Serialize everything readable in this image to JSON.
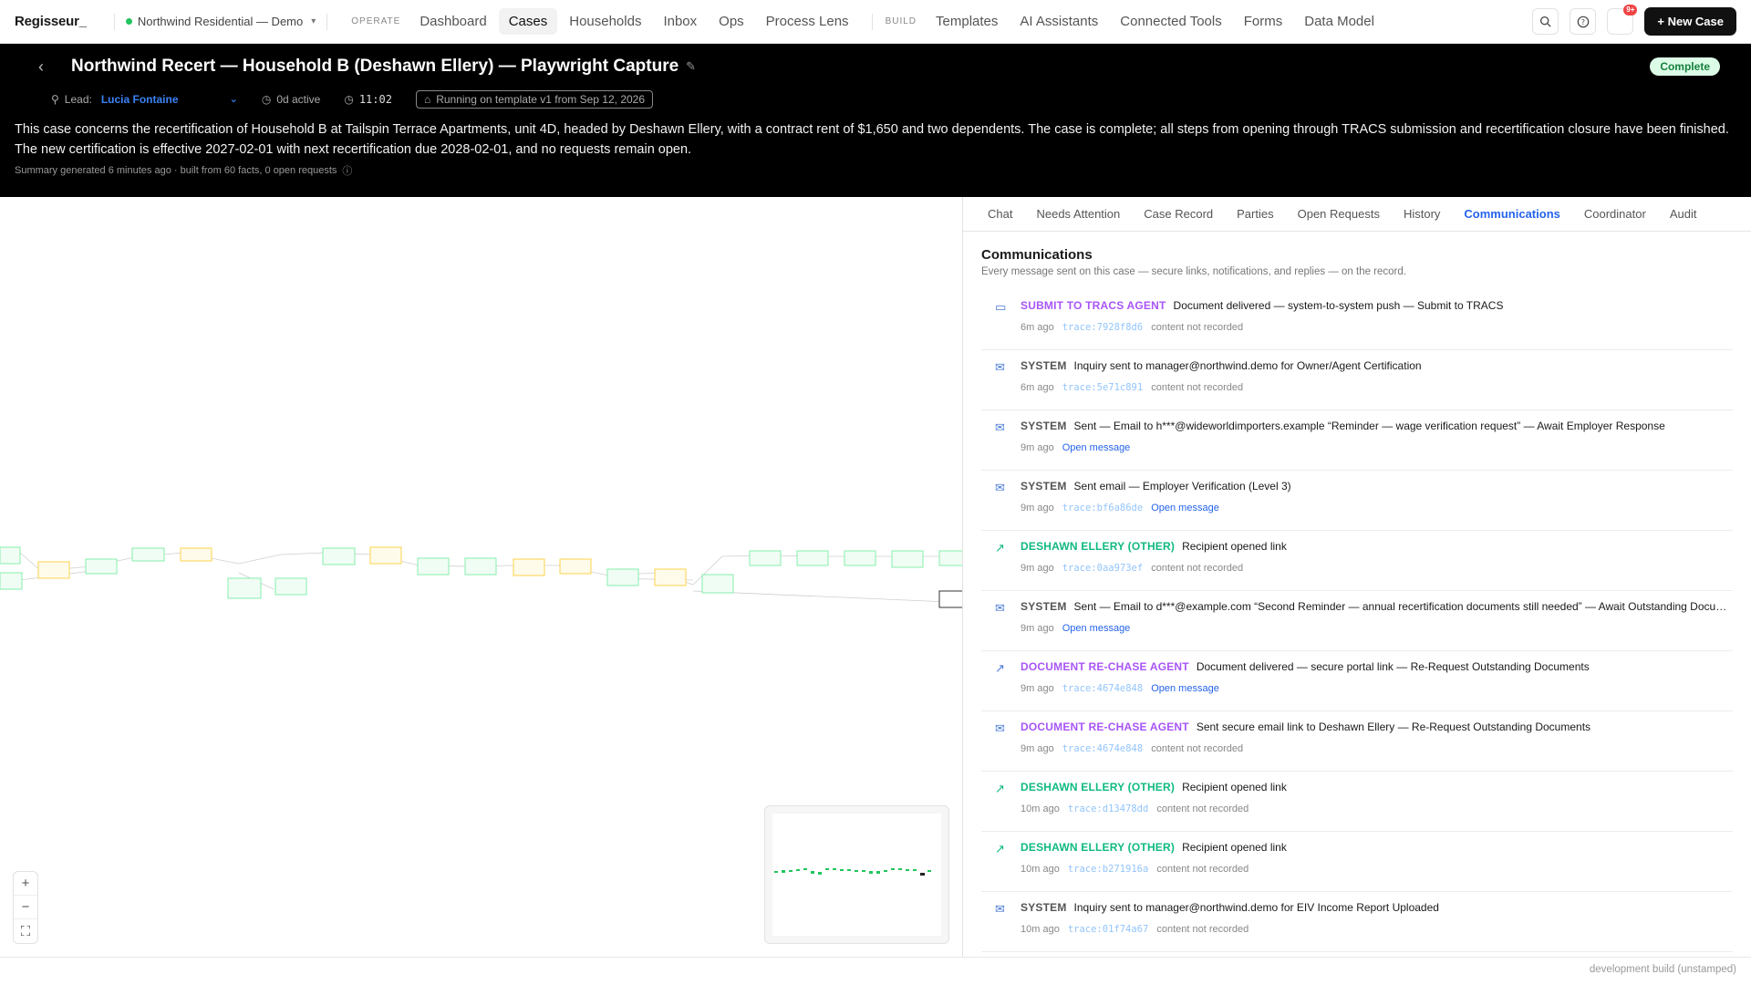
{
  "brand": "Regisseur_",
  "workspace": "Northwind Residential — Demo",
  "nav": {
    "operate_label": "OPERATE",
    "operate_items": [
      "Dashboard",
      "Cases",
      "Households",
      "Inbox",
      "Ops",
      "Process Lens"
    ],
    "build_label": "BUILD",
    "build_items": [
      "Templates",
      "AI Assistants",
      "Connected Tools",
      "Forms",
      "Data Model"
    ],
    "notifications_badge": "9+",
    "new_case_label": "+ New Case"
  },
  "case": {
    "title": "Northwind Recert — Household B (Deshawn Ellery) — Playwright Capture",
    "status": "Complete",
    "lead_label": "Lead:",
    "lead_value": "Lucia Fontaine",
    "active": "0d active",
    "timer": "11:02",
    "template": "Running on template v1 from Sep 12, 2026",
    "summary": "This case concerns the recertification of Household B at Tailspin Terrace Apartments, unit 4D, headed by Deshawn Ellery, with a contract rent of $1,650 and two dependents. The case is complete; all steps from opening through TRACS submission and recertification closure have been finished. The new certification is effective 2027-02-01 with next recertification due 2028-02-01, and no requests remain open.",
    "summary_footer": "Summary generated 6 minutes ago · built from 60 facts, 0 open requests"
  },
  "tabs": [
    "Chat",
    "Needs Attention",
    "Case Record",
    "Parties",
    "Open Requests",
    "History",
    "Communications",
    "Coordinator",
    "Audit"
  ],
  "active_tab": "Communications",
  "communications": {
    "title": "Communications",
    "subtitle": "Every message sent on this case — secure links, notifications, and replies — on the record.",
    "items": [
      {
        "icon": "chat-icon",
        "who": "SUBMIT TO TRACS AGENT",
        "kind": "agent",
        "msg": "Document delivered — system-to-system push — Submit to TRACS",
        "time": "6m ago",
        "trace": "trace:7928f8d6",
        "extra": "content not recorded"
      },
      {
        "icon": "mail-icon",
        "who": "SYSTEM",
        "kind": "system",
        "msg": "Inquiry sent to manager@northwind.demo for Owner/Agent Certification",
        "time": "6m ago",
        "trace": "trace:5e71c891",
        "extra": "content not recorded"
      },
      {
        "icon": "mail-icon",
        "who": "SYSTEM",
        "kind": "system",
        "msg": "Sent — Email to h***@wideworldimporters.example “Reminder — wage verification request” — Await Employer Response",
        "time": "9m ago",
        "trace": "",
        "extra": "Open message"
      },
      {
        "icon": "mail-icon",
        "who": "SYSTEM",
        "kind": "system",
        "msg": "Sent email — Employer Verification (Level 3)",
        "time": "9m ago",
        "trace": "trace:bf6a86de",
        "extra": "Open message"
      },
      {
        "icon": "external-link-icon",
        "who": "DESHAWN ELLERY (OTHER)",
        "kind": "other",
        "msg": "Recipient opened link",
        "time": "9m ago",
        "trace": "trace:0aa973ef",
        "extra": "content not recorded"
      },
      {
        "icon": "mail-icon",
        "who": "SYSTEM",
        "kind": "system",
        "msg": "Sent — Email to d***@example.com “Second Reminder — annual recertification documents still needed” — Await Outstanding Documents",
        "time": "9m ago",
        "trace": "",
        "extra": "Open message"
      },
      {
        "icon": "external-link-icon",
        "who": "DOCUMENT RE-CHASE AGENT",
        "kind": "agent",
        "msg": "Document delivered — secure portal link — Re-Request Outstanding Documents",
        "time": "9m ago",
        "trace": "trace:4674e848",
        "extra": "Open message"
      },
      {
        "icon": "mail-icon",
        "who": "DOCUMENT RE-CHASE AGENT",
        "kind": "agent",
        "msg": "Sent secure email link to Deshawn Ellery — Re-Request Outstanding Documents",
        "time": "9m ago",
        "trace": "trace:4674e848",
        "extra": "content not recorded"
      },
      {
        "icon": "external-link-icon",
        "who": "DESHAWN ELLERY (OTHER)",
        "kind": "other",
        "msg": "Recipient opened link",
        "time": "10m ago",
        "trace": "trace:d13478dd",
        "extra": "content not recorded"
      },
      {
        "icon": "external-link-icon",
        "who": "DESHAWN ELLERY (OTHER)",
        "kind": "other",
        "msg": "Recipient opened link",
        "time": "10m ago",
        "trace": "trace:b271916a",
        "extra": "content not recorded"
      },
      {
        "icon": "mail-icon",
        "who": "SYSTEM",
        "kind": "system",
        "msg": "Inquiry sent to manager@northwind.demo for EIV Income Report Uploaded",
        "time": "10m ago",
        "trace": "trace:01f74a67",
        "extra": "content not recorded"
      }
    ]
  },
  "colors": {
    "agent": "#a855f7",
    "system": "#555555",
    "other": "#10b981",
    "accent": "#2563eb",
    "complete_bg": "#dcfce7",
    "complete_fg": "#15803d",
    "node_green": "#86efac",
    "node_yellow": "#fcd34d"
  },
  "footer": "development build (unstamped)"
}
